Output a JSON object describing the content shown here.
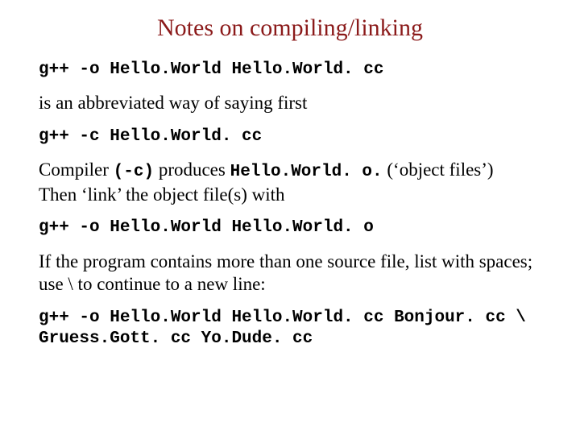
{
  "title": "Notes on compiling/linking",
  "code1": "g++ -o Hello.World Hello.World. cc",
  "prose1": "is an abbreviated way of saying first",
  "code2": "g++ -c Hello.World. cc",
  "p2_a": "Compiler ",
  "p2_flag": "(-c)",
  "p2_b": "  produces ",
  "p2_obj": "Hello.World. o.",
  "p2_c": "      (‘object files’)",
  "p2_line2": "Then ‘link’ the object file(s) with",
  "code3": "g++ -o Hello.World Hello.World. o",
  "prose3": "If the program contains more than one source file, list with spaces; use \\ to continue to a new line:",
  "code4": "g++ -o Hello.World Hello.World. cc Bonjour. cc \\\nGruess.Gott. cc Yo.Dude. cc"
}
